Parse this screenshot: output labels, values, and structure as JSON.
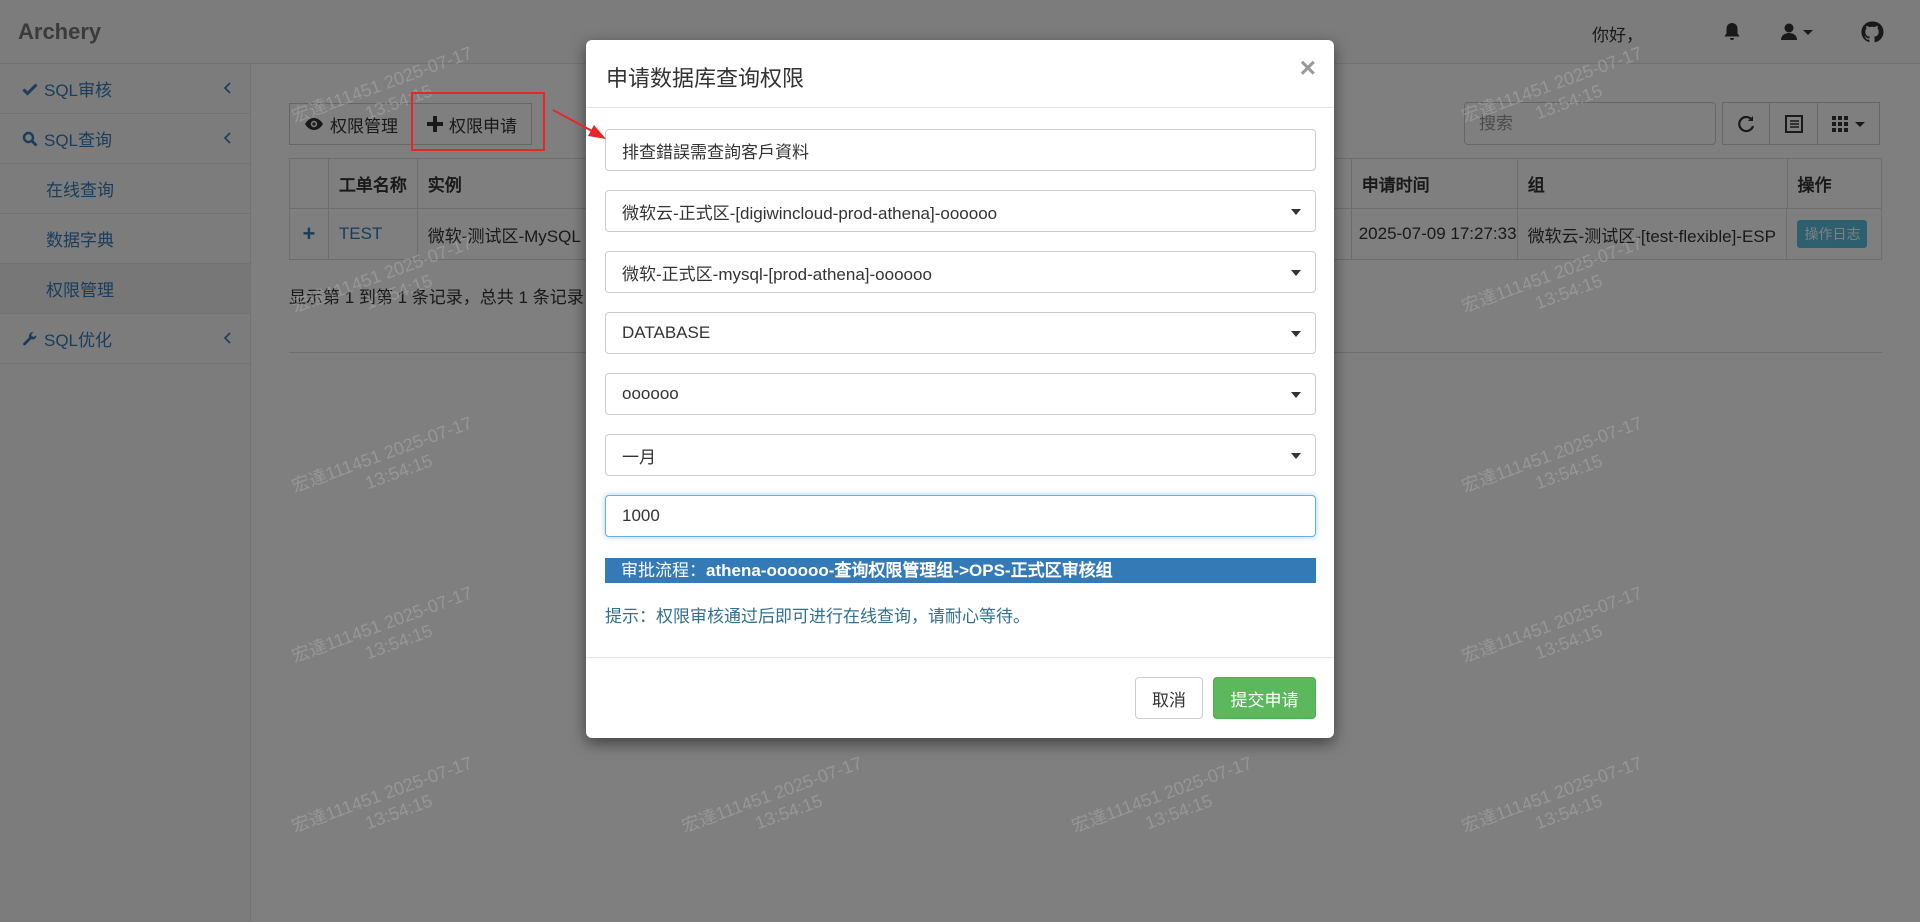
{
  "navbar": {
    "brand": "Archery",
    "greeting": "你好，",
    "icons": [
      "bell-icon",
      "user-icon",
      "github-icon"
    ]
  },
  "sidebar": {
    "items": [
      {
        "label": "SQL审核",
        "icon": "check-icon"
      },
      {
        "label": "SQL查询",
        "icon": "search-icon"
      },
      {
        "label": "在线查询"
      },
      {
        "label": "数据字典"
      },
      {
        "label": "权限管理"
      },
      {
        "label": "SQL优化",
        "icon": "wrench-icon"
      }
    ]
  },
  "toolbar": {
    "perm_manage_label": "权限管理",
    "perm_apply_label": "权限申请",
    "search_placeholder": "搜索"
  },
  "table": {
    "headers": [
      "",
      "工单名称",
      "实例",
      "申请时间",
      "组",
      "操作"
    ],
    "rows": [
      {
        "expand": "+",
        "name": "TEST",
        "instance": "微软-测试区-MySQL",
        "time": "2025-07-09 17:27:33",
        "group": "微软云-测试区-[test-flexible]-ESP",
        "action": "操作日志"
      }
    ]
  },
  "pager_text": "显示第 1 到第 1 条记录，总共 1 条记录",
  "modal": {
    "title": "申请数据库查询权限",
    "close": "×",
    "reason": "排查錯誤需查詢客戶資料",
    "cluster": "微软云-正式区-[digiwincloud-prod-athena]-oooooo",
    "instance": "微软-正式区-mysql-[prod-athena]-oooooo",
    "type": "DATABASE",
    "database": "oooooo",
    "duration": "一月",
    "limit": "1000",
    "flow_label": "审批流程：",
    "flow_value": "athena-oooooo-查询权限管理组->OPS-正式区审核组",
    "hint": "提示：权限审核通过后即可进行在线查询，请耐心等待。",
    "cancel_label": "取消",
    "submit_label": "提交申请"
  },
  "watermark": {
    "line1": "宏達111451 2025-07-17",
    "line2": "13:54:15"
  },
  "colors": {
    "link": "#337ab7",
    "success": "#5cb85c",
    "info": "#5bc0de",
    "annotation": "#e8262a"
  }
}
